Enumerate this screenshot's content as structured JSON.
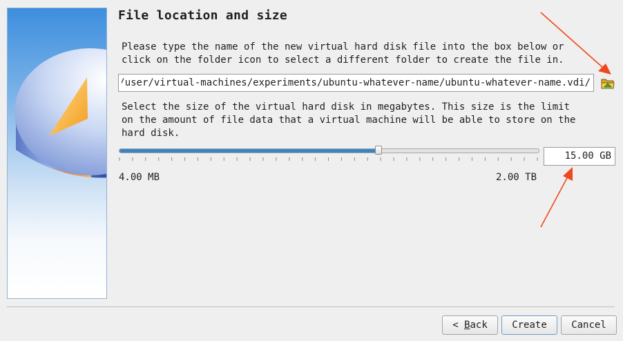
{
  "wizard": {
    "title": "File location and size",
    "location_text": "Please type the name of the new virtual hard disk file into the box below or\nclick on the folder icon to select a different folder to create the file in.",
    "location_value": "/home/user/virtual-machines/experiments/ubuntu-whatever-name/ubuntu-whatever-name.vdi",
    "folder_icon": "folder-open-icon",
    "size_text": "Select the size of the virtual hard disk in megabytes. This size is the limit\non the amount of file data that a virtual machine will be able to store on the\nhard disk.",
    "size": {
      "value_label": "15.00 GB",
      "slider_fraction": 0.62,
      "min_label": "4.00 MB",
      "max_label": "2.00 TB"
    }
  },
  "buttons": {
    "back_mnemonic": "B",
    "back_rest": "ack",
    "back_prefix": "< ",
    "create": "Create",
    "cancel": "Cancel"
  },
  "colors": {
    "annotation_arrow": "#f0481c",
    "slider_fill": "#3a84c2"
  }
}
